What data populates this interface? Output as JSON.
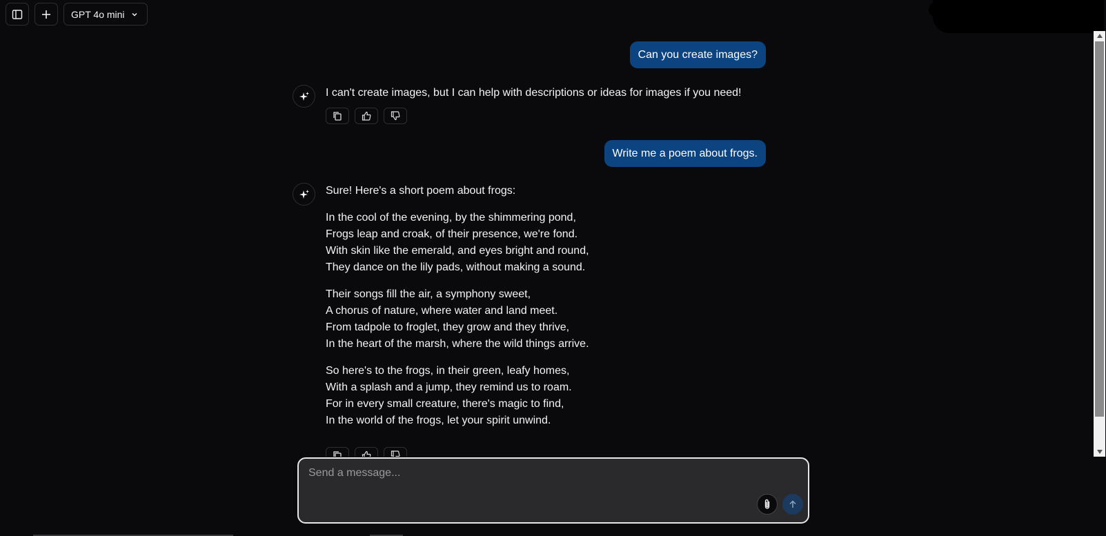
{
  "header": {
    "sidebar_toggle_icon": "sidebar-icon",
    "new_chat_icon": "plus-icon",
    "model_label": "GPT 4o mini",
    "model_chevron_icon": "chevron-down-icon"
  },
  "messages": [
    {
      "role": "user",
      "text": "Can you create images?"
    },
    {
      "role": "assistant",
      "paragraphs": [
        "I can't create images, but I can help with descriptions or ideas for images if you need!"
      ]
    },
    {
      "role": "user",
      "text": "Write me a poem about frogs."
    },
    {
      "role": "assistant",
      "intro": "Sure! Here's a short poem about frogs:",
      "stanzas": [
        [
          "In the cool of the evening, by the shimmering pond,",
          "Frogs leap and croak, of their presence, we're fond.",
          "With skin like the emerald, and eyes bright and round,",
          "They dance on the lily pads, without making a sound."
        ],
        [
          "Their songs fill the air, a symphony sweet,",
          "A chorus of nature, where water and land meet.",
          "From tadpole to froglet, they grow and they thrive,",
          "In the heart of the marsh, where the wild things arrive."
        ],
        [
          "So here's to the frogs, in their green, leafy homes,",
          "With a splash and a jump, they remind us to roam.",
          "For in every small creature, there's magic to find,",
          "In the world of the frogs, let your spirit unwind."
        ]
      ]
    }
  ],
  "message_actions": [
    "copy-icon",
    "thumbs-up-icon",
    "thumbs-down-icon"
  ],
  "composer": {
    "placeholder": "Send a message...",
    "attach_icon": "paperclip-icon",
    "send_icon": "arrow-up-icon"
  },
  "colors": {
    "background": "#0a0a0c",
    "user_bubble": "#0c4482",
    "composer_bg": "#2a2a2c",
    "send_button": "#1b3a5e"
  }
}
